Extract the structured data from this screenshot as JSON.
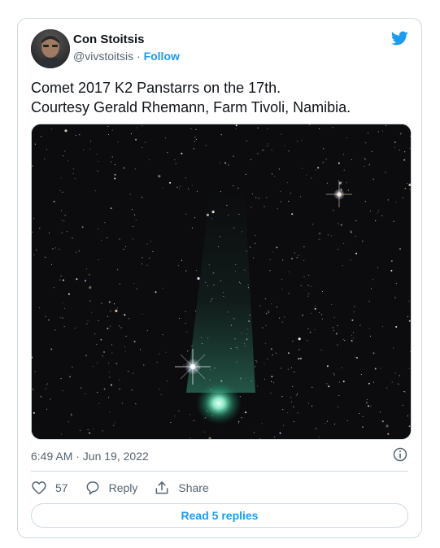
{
  "author": {
    "name": "Con Stoitsis",
    "handle": "@vivstoitsis",
    "separator": "·",
    "follow_label": "Follow"
  },
  "tweet": {
    "lines": [
      "Comet 2017 K2 Panstarrs on the 17th.",
      "Courtesy Gerald Rhemann, Farm Tivoli, Namibia."
    ],
    "timestamp": "6:49 AM · Jun 19, 2022"
  },
  "icons": {
    "logo": "twitter-bird-icon",
    "info": "info-icon",
    "like": "heart-icon",
    "reply": "reply-bubble-icon",
    "share": "share-icon"
  },
  "actions": {
    "like_count": "57",
    "reply_label": "Reply",
    "share_label": "Share"
  },
  "read_replies_label": "Read 5 replies",
  "colors": {
    "brand_blue": "#1d9bf0",
    "text_primary": "#0f1419",
    "text_secondary": "#536471",
    "border": "#cfd9de",
    "comet_glow": "#4fe0b0"
  }
}
